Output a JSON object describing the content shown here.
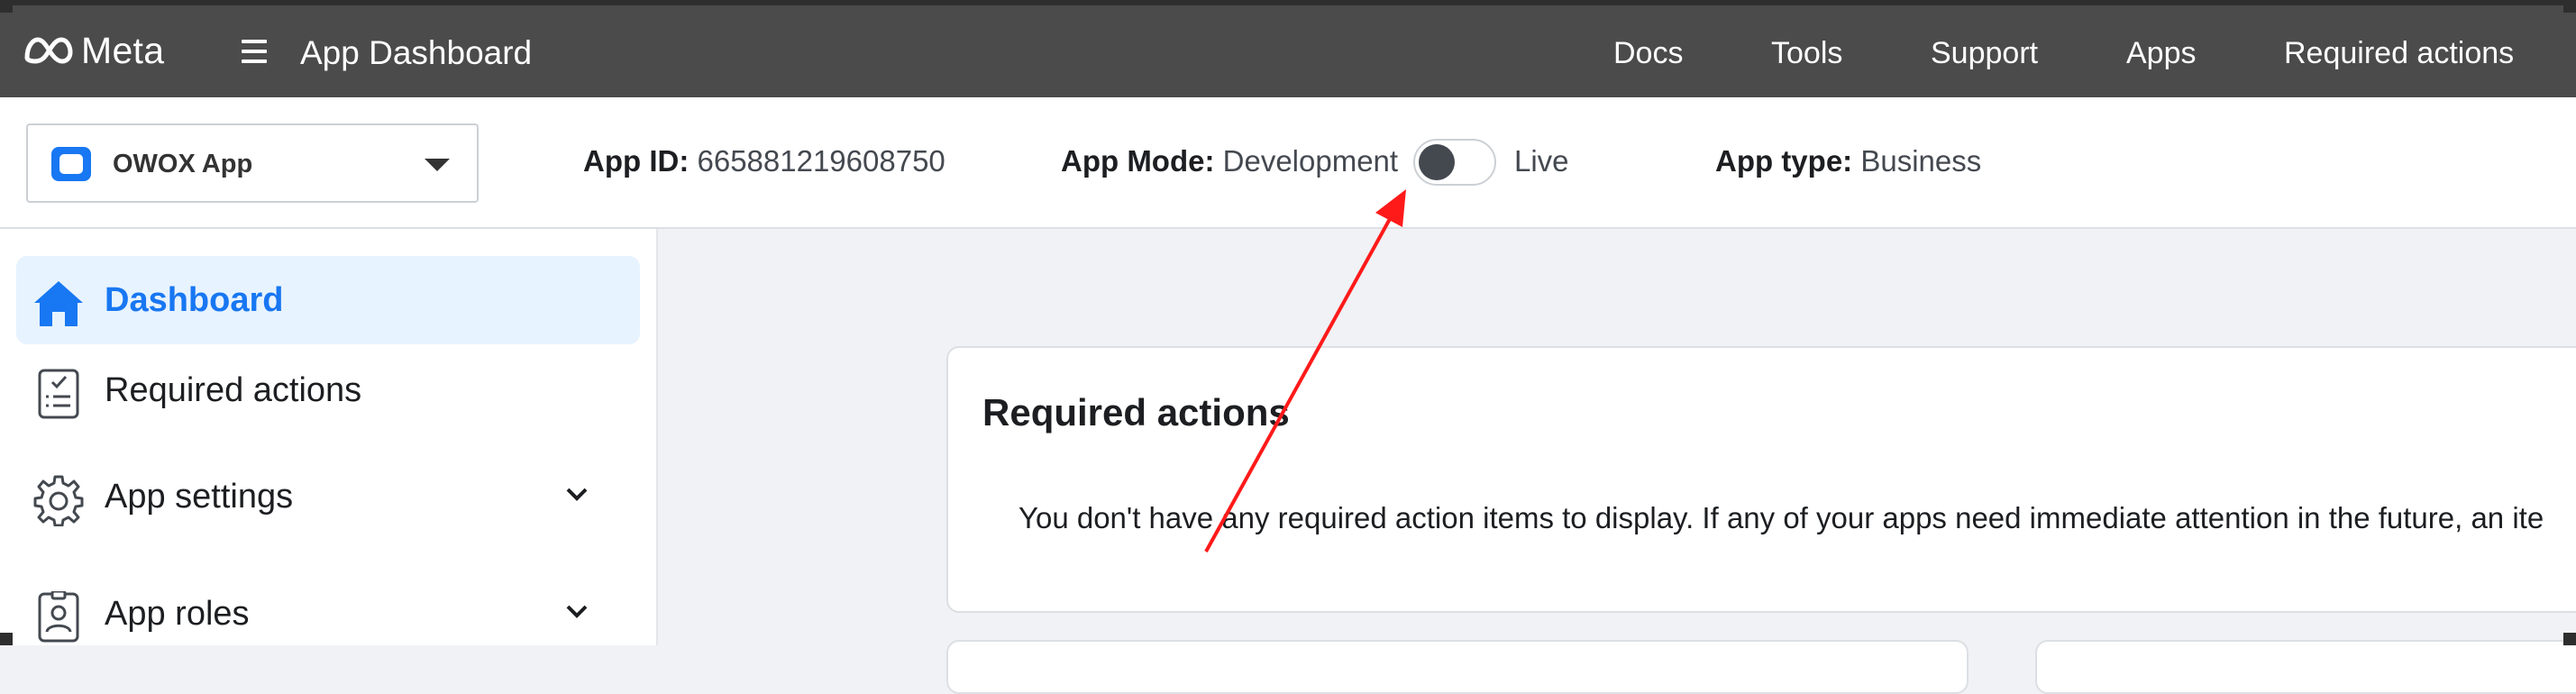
{
  "topbar": {
    "brand": "Meta",
    "title": "App Dashboard",
    "nav": [
      "Docs",
      "Tools",
      "Support",
      "Apps",
      "Required actions"
    ]
  },
  "appbar": {
    "app_name": "OWOX App",
    "app_id_label": "App ID:",
    "app_id_value": "665881219608750",
    "app_mode_label": "App Mode:",
    "app_mode_value": "Development",
    "live_label": "Live",
    "app_type_label": "App type:",
    "app_type_value": "Business",
    "toggle_on": false
  },
  "sidebar": {
    "items": [
      {
        "label": "Dashboard",
        "icon": "home-icon",
        "active": true
      },
      {
        "label": "Required actions",
        "icon": "checklist-icon",
        "active": false
      },
      {
        "label": "App settings",
        "icon": "gear-icon",
        "expandable": true
      },
      {
        "label": "App roles",
        "icon": "user-badge-icon",
        "expandable": true
      }
    ]
  },
  "main": {
    "card_title": "Required actions",
    "card_message": "You don't have any required action items to display. If any of your apps need immediate attention in the future, an ite"
  },
  "colors": {
    "topbar": "#4b4b4b",
    "accent": "#1877f2",
    "active_bg": "#e7f3ff",
    "annotation_arrow": "#ff1a1a"
  }
}
